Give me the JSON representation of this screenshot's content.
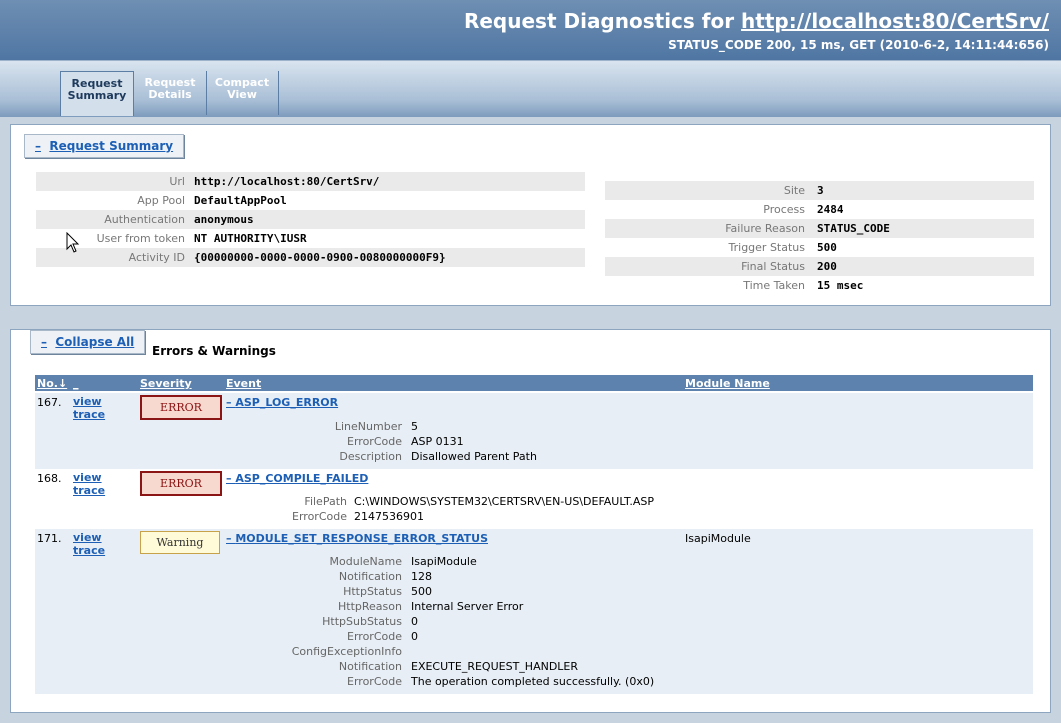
{
  "header": {
    "title_prefix": "Request Diagnostics for ",
    "title_link": "http://localhost:80/CertSrv/",
    "status_line": "STATUS_CODE 200, 15 ms, GET (2010-6-2, 14:11:44:656)"
  },
  "tabs": [
    {
      "line1": "Request",
      "line2": "Summary"
    },
    {
      "line1": "Request",
      "line2": "Details"
    },
    {
      "line1": "Compact",
      "line2": "View"
    }
  ],
  "summary": {
    "toggle": "–",
    "heading": "Request Summary",
    "left": [
      {
        "key": "Url",
        "value": "http://localhost:80/CertSrv/"
      },
      {
        "key": "App Pool",
        "value": "DefaultAppPool"
      },
      {
        "key": "Authentication",
        "value": "anonymous"
      },
      {
        "key": "User from token",
        "value": "NT AUTHORITY\\IUSR"
      },
      {
        "key": "Activity ID",
        "value": "{00000000-0000-0000-0900-0080000000F9}"
      }
    ],
    "right": [
      {
        "key": "Site",
        "value": "3"
      },
      {
        "key": "Process",
        "value": "2484"
      },
      {
        "key": "Failure Reason",
        "value": "STATUS_CODE"
      },
      {
        "key": "Trigger Status",
        "value": "500"
      },
      {
        "key": "Final Status",
        "value": "200"
      },
      {
        "key": "Time Taken",
        "value": "15 msec"
      }
    ]
  },
  "errors": {
    "toggle": "–",
    "collapse_label": "Collapse All",
    "title": "Errors & Warnings",
    "columns": {
      "no": "No.↓",
      "blank": "_",
      "severity": "Severity",
      "event": "Event",
      "module": "Module Name"
    },
    "entries": [
      {
        "no": "167.",
        "view1": "view",
        "view2": "trace",
        "severity": "ERROR",
        "sev_type": "error",
        "toggle": "–",
        "event": "ASP_LOG_ERROR",
        "module": "",
        "details": [
          {
            "key": "LineNumber",
            "value": "5"
          },
          {
            "key": "ErrorCode",
            "value": "ASP 0131"
          },
          {
            "key": "Description",
            "value": "Disallowed Parent Path"
          }
        ]
      },
      {
        "no": "168.",
        "view1": "view",
        "view2": "trace",
        "severity": "ERROR",
        "sev_type": "error",
        "toggle": "–",
        "event": "ASP_COMPILE_FAILED",
        "module": "",
        "details": [
          {
            "key": "FilePath",
            "value": "C:\\WINDOWS\\SYSTEM32\\CERTSRV\\EN-US\\DEFAULT.ASP"
          },
          {
            "key": "ErrorCode",
            "value": "2147536901"
          }
        ]
      },
      {
        "no": "171.",
        "view1": "view",
        "view2": "trace",
        "severity": "Warning",
        "sev_type": "warning",
        "toggle": "–",
        "event": "MODULE_SET_RESPONSE_ERROR_STATUS",
        "module": "IsapiModule",
        "details": [
          {
            "key": "ModuleName",
            "value": "IsapiModule"
          },
          {
            "key": "Notification",
            "value": "128"
          },
          {
            "key": "HttpStatus",
            "value": "500"
          },
          {
            "key": "HttpReason",
            "value": "Internal Server Error"
          },
          {
            "key": "HttpSubStatus",
            "value": "0"
          },
          {
            "key": "ErrorCode",
            "value": "0"
          },
          {
            "key": "ConfigExceptionInfo",
            "value": ""
          },
          {
            "key": "Notification",
            "value": "EXECUTE_REQUEST_HANDLER"
          },
          {
            "key": "ErrorCode",
            "value": "The operation completed successfully. (0x0)"
          }
        ]
      }
    ]
  }
}
